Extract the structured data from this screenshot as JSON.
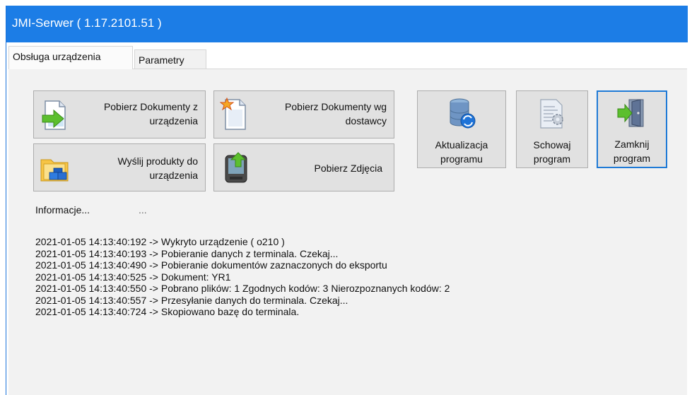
{
  "window": {
    "title": "JMI-Serwer ( 1.17.2101.51 )"
  },
  "tabs": [
    {
      "label": "Obsługa urządzenia",
      "active": true
    },
    {
      "label": "Parametry",
      "active": false
    }
  ],
  "buttons": {
    "fetch_docs": {
      "line1": "Pobierz Dokumenty z",
      "line2": "urządzenia",
      "icon": "document-import-icon"
    },
    "fetch_docs_supplier": {
      "line1": "Pobierz Dokumenty wg",
      "line2": "dostawcy",
      "icon": "document-star-icon"
    },
    "send_products": {
      "line1": "Wyślij produkty do",
      "line2": "urządzenia",
      "icon": "folder-boxes-icon"
    },
    "fetch_photos": {
      "line1": "Pobierz Zdjęcia",
      "icon": "device-upload-icon"
    },
    "update": {
      "line1": "Aktualizacja",
      "line2": "programu",
      "icon": "database-sync-icon"
    },
    "hide": {
      "line1": "Schowaj",
      "line2": "program",
      "icon": "document-gear-icon"
    },
    "close": {
      "line1": "Zamknij",
      "line2": "program",
      "icon": "exit-door-icon"
    }
  },
  "info": {
    "label": "Informacje...",
    "value": "..."
  },
  "log": [
    "2021-01-05 14:13:40:192 -> Wykryto urządzenie ( o210 )",
    "2021-01-05 14:13:40:193 -> Pobieranie danych z terminala. Czekaj...",
    "2021-01-05 14:13:40:490 -> Pobieranie dokumentów zaznaczonych do eksportu",
    "2021-01-05 14:13:40:525 -> Dokument: YR1",
    "2021-01-05 14:13:40:550 -> Pobrano plików: 1 Zgodnych kodów: 3 Nierozpoznanych kodów: 2",
    "2021-01-05 14:13:40:557 -> Przesyłanie danych do terminala. Czekaj...",
    "2021-01-05 14:13:40:724 -> Skopiowano bazę do terminala."
  ]
}
